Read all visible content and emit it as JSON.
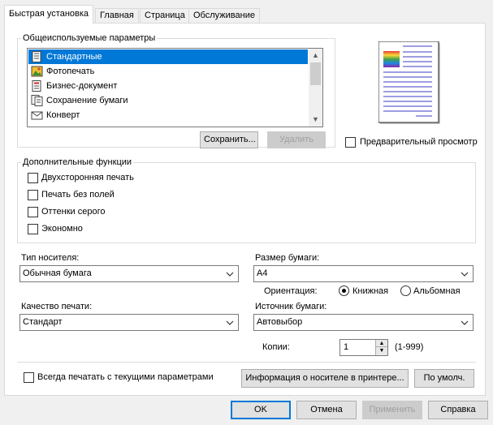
{
  "tabs": [
    {
      "label": "Быстрая установка",
      "active": true
    },
    {
      "label": "Главная",
      "active": false
    },
    {
      "label": "Страница",
      "active": false
    },
    {
      "label": "Обслуживание",
      "active": false
    }
  ],
  "presets": {
    "title": "Общеиспользуемые параметры",
    "items": [
      {
        "label": "Стандартные",
        "icon": "standard-doc-icon",
        "selected": true
      },
      {
        "label": "Фотопечать",
        "icon": "photo-print-icon",
        "selected": false
      },
      {
        "label": "Бизнес-документ",
        "icon": "business-doc-icon",
        "selected": false
      },
      {
        "label": "Сохранение бумаги",
        "icon": "paper-save-icon",
        "selected": false
      },
      {
        "label": "Конверт",
        "icon": "envelope-icon",
        "selected": false
      }
    ],
    "save_label": "Сохранить...",
    "delete_label": "Удалить"
  },
  "preview": {
    "label": "Предварительный просмотр",
    "checked": false
  },
  "extra": {
    "title": "Дополнительные функции",
    "options": [
      {
        "label": "Двухсторонняя печать",
        "checked": false
      },
      {
        "label": "Печать без полей",
        "checked": false
      },
      {
        "label": "Оттенки серого",
        "checked": false
      },
      {
        "label": "Экономно",
        "checked": false
      }
    ]
  },
  "media_type": {
    "label": "Тип носителя:",
    "value": "Обычная бумага"
  },
  "paper_size": {
    "label": "Размер бумаги:",
    "value": "А4"
  },
  "orientation": {
    "label": "Ориентация:",
    "portrait": "Книжная",
    "landscape": "Альбомная",
    "selected": "portrait"
  },
  "print_quality": {
    "label": "Качество печати:",
    "value": "Стандарт"
  },
  "paper_source": {
    "label": "Источник бумаги:",
    "value": "Автовыбор"
  },
  "copies": {
    "label": "Копии:",
    "value": "1",
    "range": "(1-999)"
  },
  "always_print": {
    "label": "Всегда печатать с текущими параметрами",
    "checked": false
  },
  "media_info_label": "Информация о носителе в принтере...",
  "defaults_label": "По умолч.",
  "footer": {
    "ok": "OK",
    "cancel": "Отмена",
    "apply": "Применить",
    "help": "Справка"
  },
  "colors": {
    "selection": "#0078d7",
    "panel_bg": "#ffffff",
    "window_bg": "#f0f0f0"
  }
}
